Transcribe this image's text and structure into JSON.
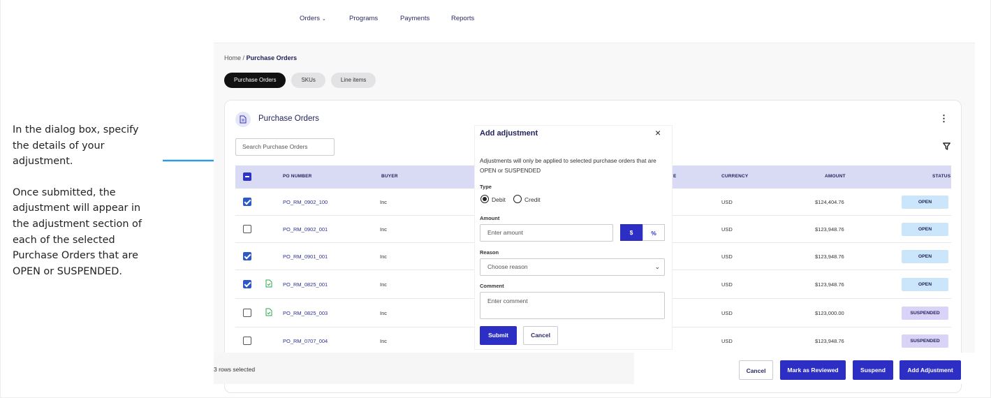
{
  "callout": {
    "para1": "In the dialog box, specify the details of your adjustment.",
    "para2": "Once submitted, the adjustment will appear in the adjustment section of each of the selected Purchase Orders that are OPEN or SUSPENDED."
  },
  "nav": {
    "orders": "Orders",
    "programs": "Programs",
    "payments": "Payments",
    "reports": "Reports"
  },
  "breadcrumb": {
    "home": "Home",
    "sep": "/",
    "current": "Purchase Orders"
  },
  "tabs": [
    "Purchase Orders",
    "SKUs",
    "Line items"
  ],
  "card": {
    "title": "Purchase Orders",
    "search_placeholder": "Search Purchase Orders"
  },
  "table": {
    "headers": {
      "po": "PO NUMBER",
      "buyer": "BUYER",
      "date_partial": "E",
      "currency": "CURRENCY",
      "amount": "AMOUNT",
      "status": "STATUS"
    },
    "rows": [
      {
        "po": "PO_RM_0902_100",
        "buyer": "Inc",
        "currency": "USD",
        "amount": "$124,404.76",
        "status": "OPEN",
        "checked": true,
        "doc": false
      },
      {
        "po": "PO_RM_0902_001",
        "buyer": "Inc",
        "currency": "USD",
        "amount": "$123,948.76",
        "status": "OPEN",
        "checked": false,
        "doc": false
      },
      {
        "po": "PO_RM_0901_001",
        "buyer": "Inc",
        "currency": "USD",
        "amount": "$123,948.76",
        "status": "OPEN",
        "checked": true,
        "doc": false
      },
      {
        "po": "PO_RM_0825_001",
        "buyer": "Inc",
        "currency": "USD",
        "amount": "$123,948.76",
        "status": "OPEN",
        "checked": true,
        "doc": true
      },
      {
        "po": "PO_RM_0825_003",
        "buyer": "Inc",
        "currency": "USD",
        "amount": "$123,000.00",
        "status": "SUSPENDED",
        "checked": false,
        "doc": true
      },
      {
        "po": "PO_RM_0707_004",
        "buyer": "Inc",
        "currency": "USD",
        "amount": "$123,948.76",
        "status": "SUSPENDED",
        "checked": false,
        "doc": false
      }
    ]
  },
  "footer": {
    "selected": "3 rows selected",
    "cancel": "Cancel",
    "mark_reviewed": "Mark as Reviewed",
    "suspend": "Suspend",
    "add_adjustment": "Add Adjustment"
  },
  "dialog": {
    "title": "Add adjustment",
    "close": "×",
    "note": "Adjustments will only be applied to selected purchase orders that are OPEN or SUSPENDED",
    "type_label": "Type",
    "debit": "Debit",
    "credit": "Credit",
    "amount_label": "Amount",
    "amount_placeholder": "Enter amount",
    "dollar": "$",
    "percent": "%",
    "reason_label": "Reason",
    "reason_placeholder": "Choose reason",
    "comment_label": "Comment",
    "comment_placeholder": "Enter comment",
    "submit": "Submit",
    "cancel": "Cancel"
  },
  "colors": {
    "accent": "#2c2ec4",
    "open_badge": "#cbe6fb",
    "suspended_badge": "#d9d3f7",
    "header_row": "#d9dbf5",
    "arrow": "#2e9be0"
  }
}
